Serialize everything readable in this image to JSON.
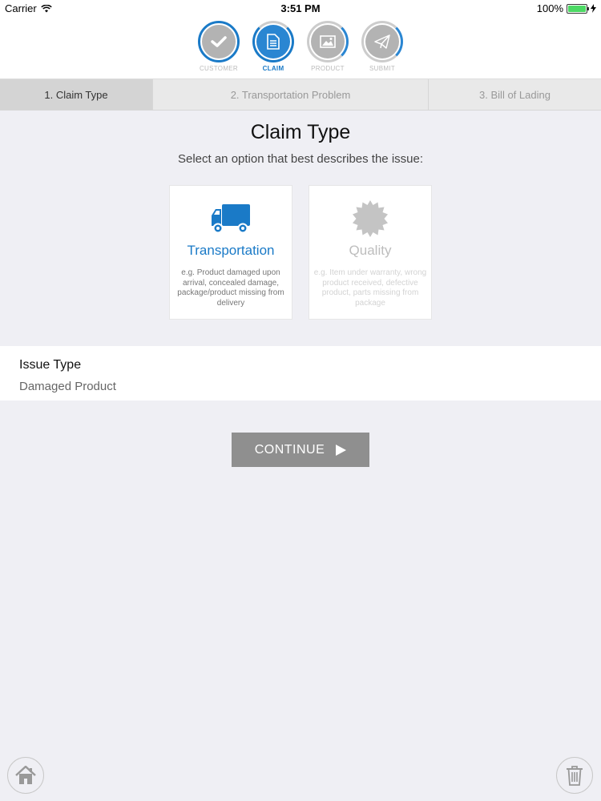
{
  "status_bar": {
    "carrier": "Carrier",
    "time": "3:51 PM",
    "battery": "100%"
  },
  "steps": [
    {
      "label": "CUSTOMER",
      "icon": "check-icon",
      "state": "done"
    },
    {
      "label": "CLAIM",
      "icon": "document-icon",
      "state": "active"
    },
    {
      "label": "PRODUCT",
      "icon": "image-icon",
      "state": "pending"
    },
    {
      "label": "SUBMIT",
      "icon": "paper-plane-icon",
      "state": "pending"
    }
  ],
  "tabs": [
    {
      "label": "1. Claim Type",
      "active": true
    },
    {
      "label": "2. Transportation Problem",
      "active": false
    },
    {
      "label": "3. Bill of Lading",
      "active": false
    }
  ],
  "main": {
    "title": "Claim Type",
    "subtitle": "Select an option that best describes the issue:",
    "options": [
      {
        "title": "Transportation",
        "description": "e.g. Product damaged upon arrival, concealed damage, package/product missing from delivery",
        "icon": "truck-icon",
        "selected": true
      },
      {
        "title": "Quality",
        "description": "e.g. Item under warranty, wrong product received, defective product, parts missing from package",
        "icon": "badge-icon",
        "selected": false
      }
    ]
  },
  "issue": {
    "label": "Issue Type",
    "value": "Damaged Product"
  },
  "actions": {
    "continue_label": "CONTINUE"
  },
  "colors": {
    "accent": "#1a7ac7",
    "button": "#8f8f8f",
    "background": "#efeff4"
  }
}
